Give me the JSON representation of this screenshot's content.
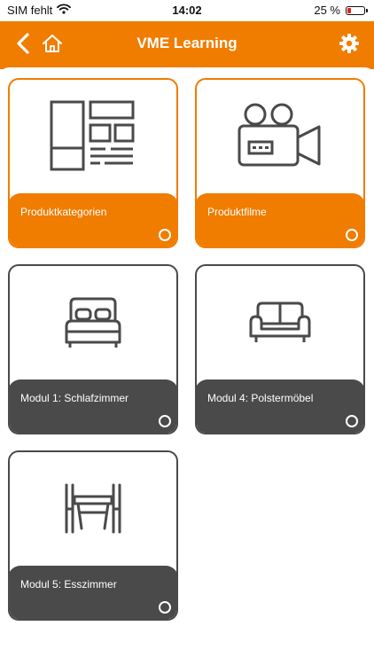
{
  "status": {
    "carrier": "SIM fehlt",
    "time": "14:02",
    "battery": "25 %",
    "battery_level": 0.25,
    "battery_color": "#e02020"
  },
  "header": {
    "title": "VME Learning",
    "color": "#f07c00",
    "back_icon": "chevron-left-icon",
    "home_icon": "home-icon",
    "settings_icon": "gear-icon"
  },
  "tiles": [
    {
      "label": "Produktkategorien",
      "icon": "layout-icon",
      "active": true
    },
    {
      "label": "Produktfilme",
      "icon": "video-camera-icon",
      "active": true
    },
    {
      "label": "Modul 1: Schlafzimmer",
      "icon": "bed-icon",
      "active": false
    },
    {
      "label": "Modul 4: Polstermöbel",
      "icon": "sofa-icon",
      "active": false
    },
    {
      "label": "Modul 5: Esszimmer",
      "icon": "dining-table-icon",
      "active": false
    }
  ]
}
